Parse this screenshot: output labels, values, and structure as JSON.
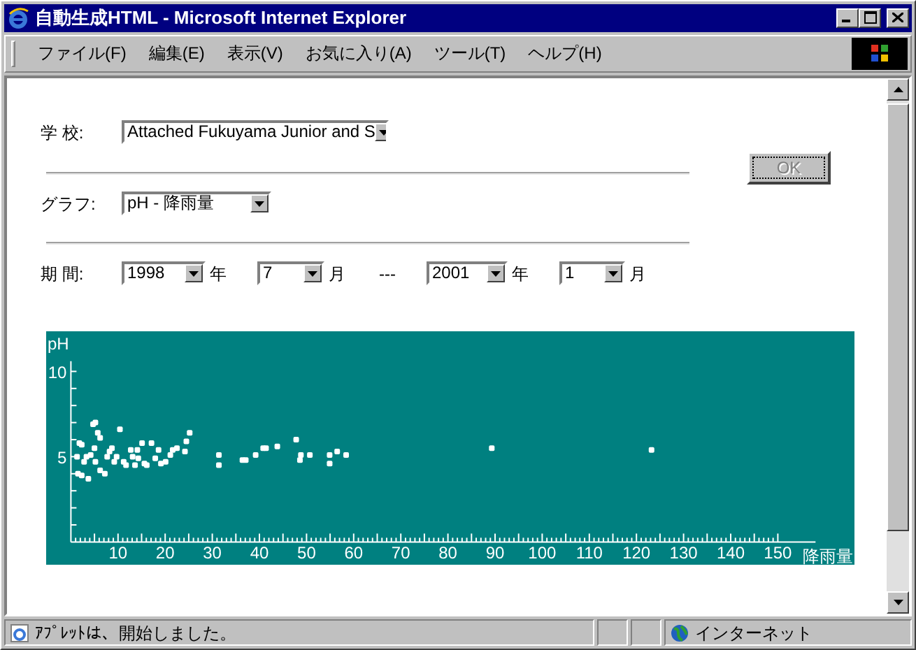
{
  "window": {
    "title": "自動生成HTML - Microsoft Internet Explorer"
  },
  "menu": [
    "ファイル(F)",
    "編集(E)",
    "表示(V)",
    "お気に入り(A)",
    "ツール(T)",
    "ヘルプ(H)"
  ],
  "form": {
    "school": {
      "label": "学 校:",
      "value": "Attached Fukuyama Junior and S"
    },
    "graph": {
      "label": "グラフ:",
      "value": "pH - 降雨量"
    },
    "period": {
      "label": "期 間:",
      "separator": "---",
      "fields": [
        {
          "value": "1998",
          "unit": "年"
        },
        {
          "value": "7",
          "unit": "月"
        },
        {
          "value": "2001",
          "unit": "年"
        },
        {
          "value": "1",
          "unit": "月"
        }
      ]
    },
    "ok_button": {
      "label": "OK",
      "disabled": true
    }
  },
  "chart": {
    "chart_data": {
      "type": "scatter",
      "xlabel": "降雨量",
      "ylabel": "pH",
      "xlim": [
        0,
        158
      ],
      "ylim": [
        0,
        10.6
      ],
      "xticks": [
        10,
        20,
        30,
        40,
        50,
        60,
        70,
        80,
        90,
        100,
        110,
        120,
        130,
        140,
        150
      ],
      "yticks": [
        5,
        10
      ],
      "x": [
        1.3,
        1.8,
        2.3,
        1.5,
        2.3,
        3.7,
        3.3,
        2.8,
        4.2,
        4.7,
        5.2,
        5.7,
        6.2,
        5.0,
        5.2,
        6.2,
        7.2,
        7.7,
        8.2,
        8.7,
        9.2,
        9.7,
        10.4,
        11.2,
        11.7,
        12.7,
        13.1,
        13.6,
        14.1,
        14.3,
        15.1,
        15.6,
        16.1,
        17.1,
        17.9,
        18.6,
        19.1,
        20.1,
        21.1,
        21.6,
        22.5,
        24.2,
        24.5,
        25.2,
        31.4,
        31.4,
        36.4,
        37.1,
        39.2,
        40.8,
        41.4,
        43.8,
        47.8,
        48.6,
        48.8,
        50.7,
        54.9,
        54.9,
        56.5,
        58.4,
        89.3,
        123.2
      ],
      "series": [
        {
          "color": "#ffffff",
          "values": [
            5.0,
            5.8,
            5.7,
            4.0,
            3.9,
            3.7,
            5.0,
            4.7,
            5.1,
            6.9,
            7.0,
            6.4,
            6.1,
            5.5,
            4.7,
            4.2,
            4.0,
            5.0,
            5.3,
            5.5,
            4.7,
            5.0,
            6.6,
            4.7,
            4.5,
            5.4,
            5.0,
            4.5,
            5.4,
            4.9,
            5.8,
            4.6,
            4.5,
            5.8,
            4.9,
            5.4,
            4.6,
            4.7,
            5.1,
            5.4,
            5.5,
            5.3,
            5.9,
            6.4,
            5.1,
            4.5,
            4.8,
            4.8,
            5.1,
            5.5,
            5.5,
            5.6,
            6.0,
            4.8,
            5.1,
            5.1,
            5.1,
            4.6,
            5.3,
            5.1,
            5.5,
            5.4
          ]
        }
      ]
    }
  },
  "status_bar": {
    "message": "ｱﾌﾟﾚｯﾄは、開始しました。",
    "zone": "インターネット"
  }
}
